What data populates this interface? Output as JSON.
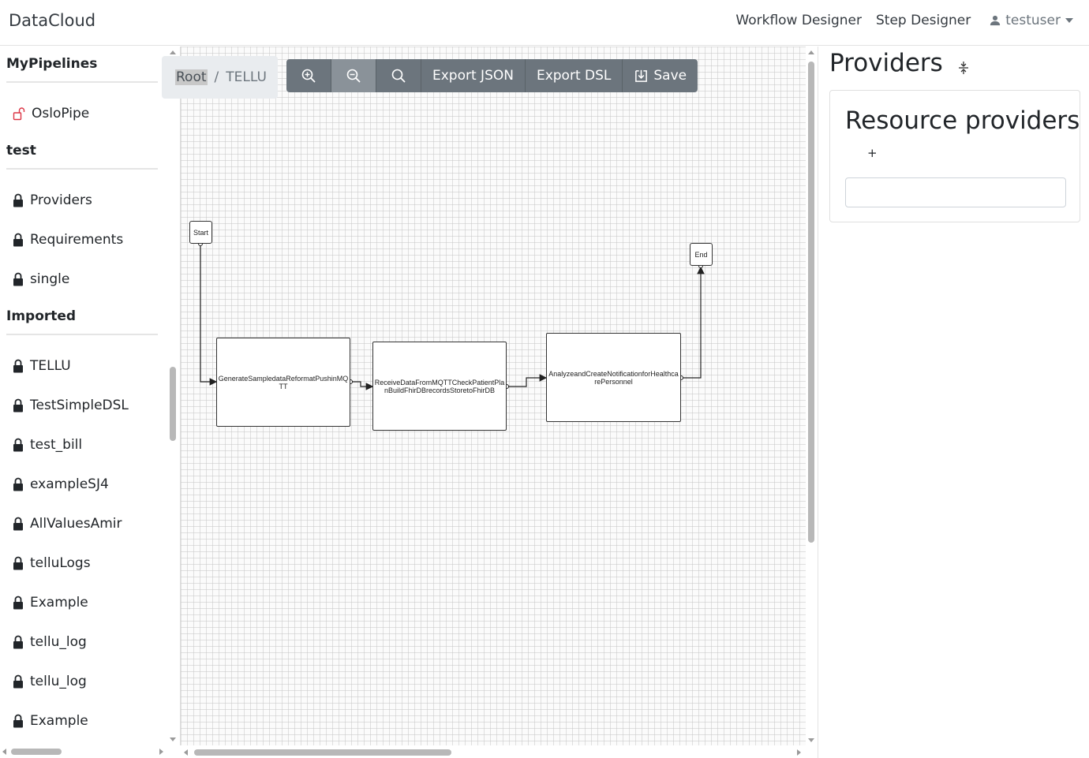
{
  "navbar": {
    "brand": "DataCloud",
    "links": [
      "Workflow Designer",
      "Step Designer"
    ],
    "user": "testuser"
  },
  "sidebar": {
    "groups": [
      {
        "title": "MyPipelines",
        "items": [
          {
            "label": "OsloPipe",
            "icon": "lock-open-icon",
            "color": "#dc3545"
          }
        ]
      },
      {
        "title": "test",
        "items": [
          {
            "label": "Providers",
            "icon": "lock-icon"
          },
          {
            "label": "Requirements",
            "icon": "lock-icon"
          },
          {
            "label": "single",
            "icon": "lock-icon"
          }
        ]
      },
      {
        "title": "Imported",
        "items": [
          {
            "label": "TELLU",
            "icon": "lock-icon"
          },
          {
            "label": "TestSimpleDSL",
            "icon": "lock-icon"
          },
          {
            "label": "test_bill",
            "icon": "lock-icon"
          },
          {
            "label": "exampleSJ4",
            "icon": "lock-icon"
          },
          {
            "label": "AllValuesAmir",
            "icon": "lock-icon"
          },
          {
            "label": "telluLogs",
            "icon": "lock-icon"
          },
          {
            "label": "Example",
            "icon": "lock-icon"
          },
          {
            "label": "tellu_log",
            "icon": "lock-icon"
          },
          {
            "label": "tellu_log",
            "icon": "lock-icon"
          },
          {
            "label": "Example",
            "icon": "lock-icon"
          }
        ]
      }
    ]
  },
  "breadcrumb": {
    "root": "Root",
    "separator": "/",
    "current": "TELLU"
  },
  "toolbar": {
    "zoom_in_icon": "zoom-in-icon",
    "zoom_out_icon": "zoom-out-icon",
    "zoom_fit_icon": "search-icon",
    "export_json": "Export JSON",
    "export_dsl": "Export DSL",
    "save": "Save",
    "button_color": "#6c757d"
  },
  "workflow": {
    "start": "Start",
    "end": "End",
    "steps": [
      "GenerateSampledataReformatPushinMQTT",
      "ReceiveDataFromMQTTCheckPatientPlanBuildFhirDBrecordsStoretoFhirDB",
      "AnalyzeandCreateNotificationforHealthcarePersonnel"
    ]
  },
  "right_panel": {
    "title": "Providers",
    "card_title": "Resource providers",
    "add_label": "+",
    "input_value": ""
  }
}
